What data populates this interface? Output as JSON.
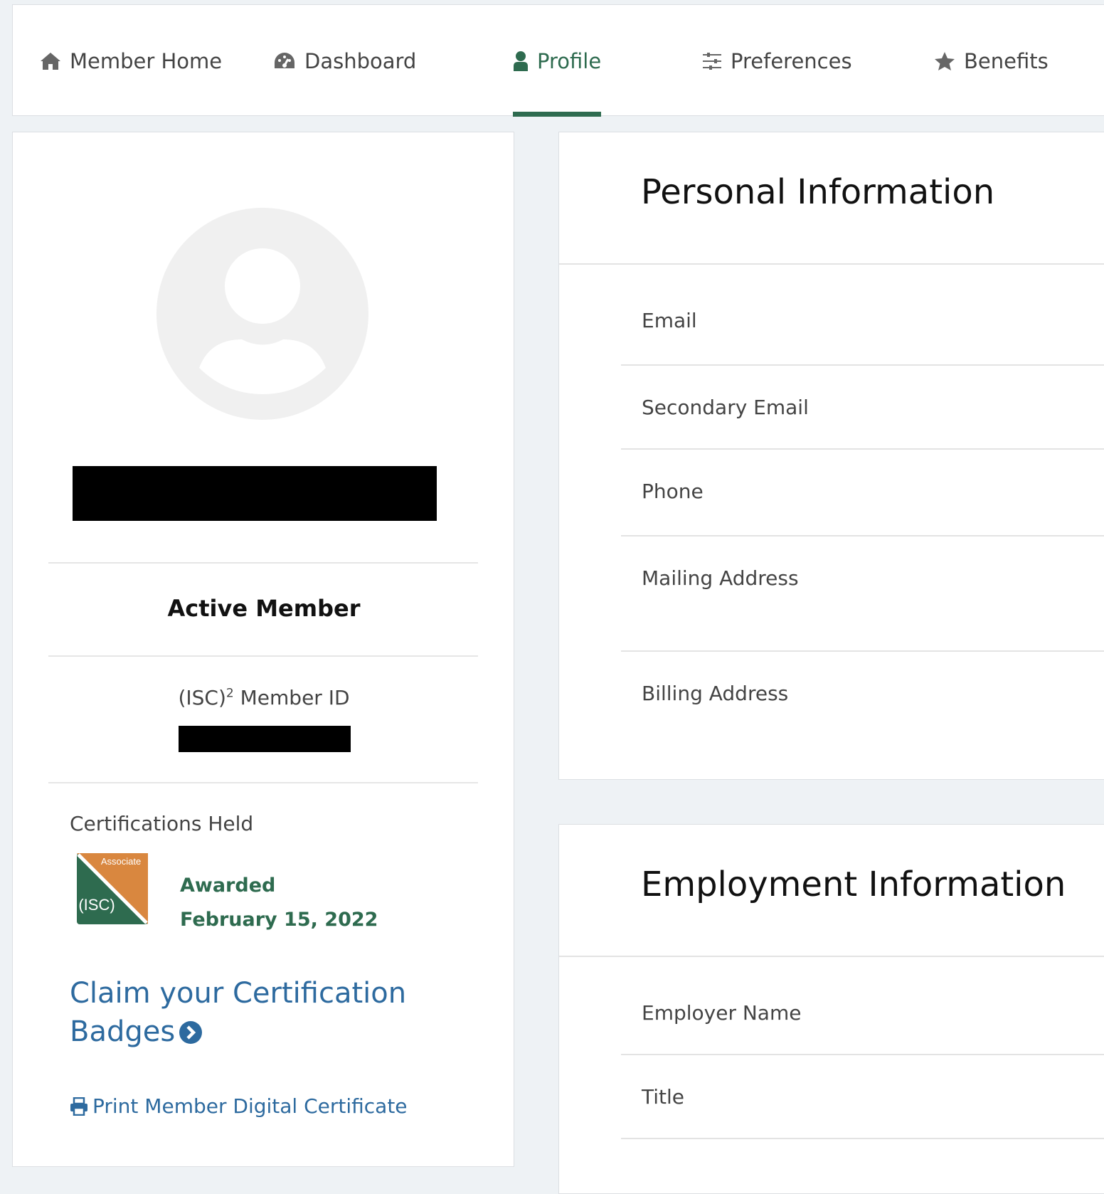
{
  "nav": {
    "items": [
      {
        "label": "Member Home",
        "icon": "home-icon"
      },
      {
        "label": "Dashboard",
        "icon": "dashboard-icon"
      },
      {
        "label": "Profile",
        "icon": "user-icon"
      },
      {
        "label": "Preferences",
        "icon": "sliders-icon"
      },
      {
        "label": "Benefits",
        "icon": "star-icon"
      }
    ],
    "active": "Profile"
  },
  "profile": {
    "status": "Active Member",
    "member_id_prefix": "(ISC)",
    "member_id_sup": "2",
    "member_id_suffix": " Member ID",
    "certifications_label": "Certifications Held",
    "badge_text_top": "Associate",
    "badge_text_bottom": "(ISC)",
    "awarded_label": "Awarded",
    "awarded_date": "February 15, 2022",
    "claim_line1": "Claim your Certification",
    "claim_line2": "Badges",
    "print_label": "Print Member Digital Certificate"
  },
  "personal": {
    "title": "Personal Information",
    "fields": [
      "Email",
      "Secondary Email",
      "Phone",
      "Mailing Address",
      "Billing Address"
    ]
  },
  "employment": {
    "title": "Employment Information",
    "fields": [
      "Employer Name",
      "Title"
    ]
  },
  "colors": {
    "accent_green": "#2e6b4f",
    "link_blue": "#2d6a9f",
    "badge_orange": "#d9873f",
    "badge_green": "#2e6b4f"
  }
}
